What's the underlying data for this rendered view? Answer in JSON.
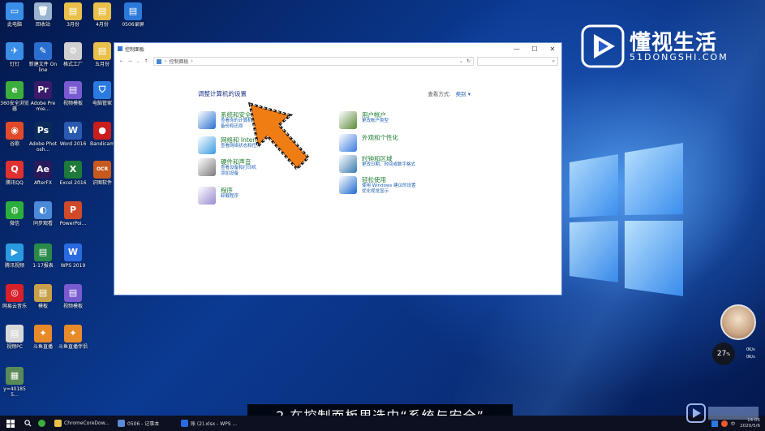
{
  "desktop_icons": [
    {
      "label": "此电脑",
      "color": "#3a8ee6",
      "glyph": "▭"
    },
    {
      "label": "回收站",
      "color": "#9ab3cf",
      "glyph": "🗑"
    },
    {
      "label": "3月份",
      "color": "#e8c04a",
      "glyph": "▤"
    },
    {
      "label": "4月份",
      "color": "#e8c04a",
      "glyph": "▤"
    },
    {
      "label": "0506录屏",
      "color": "#2b79d8",
      "glyph": "▤"
    },
    {
      "label": "钉钉",
      "color": "#3a8ee6",
      "glyph": "✈"
    },
    {
      "label": "新建文件 Online",
      "color": "#2a6fd0",
      "glyph": "✎"
    },
    {
      "label": "格式工厂",
      "color": "#d0d0d0",
      "glyph": "⚙"
    },
    {
      "label": "五月份",
      "color": "#e8c04a",
      "glyph": "▤"
    },
    {
      "label": "360安全浏览器",
      "color": "#3cae3c",
      "glyph": "e"
    },
    {
      "label": "Adobe Premie...",
      "color": "#3a1a6a",
      "glyph": "Pr"
    },
    {
      "label": "视频模板",
      "color": "#7a5ad0",
      "glyph": "▤"
    },
    {
      "label": "电脑管家",
      "color": "#2a7ae0",
      "glyph": "⛉"
    },
    {
      "label": "谷歌",
      "color": "#e04a2a",
      "glyph": "◉"
    },
    {
      "label": "Adobe Photosh...",
      "color": "#0a2a5a",
      "glyph": "Ps"
    },
    {
      "label": "Word 2016",
      "color": "#2a5ab0",
      "glyph": "W"
    },
    {
      "label": "Bandicam",
      "color": "#c81e1e",
      "glyph": "●"
    },
    {
      "label": "腾讯QQ",
      "color": "#e03030",
      "glyph": "Q"
    },
    {
      "label": "AfterFX",
      "color": "#2a1a5a",
      "glyph": "Ae"
    },
    {
      "label": "Excel 2016",
      "color": "#1e7a3a",
      "glyph": "X"
    },
    {
      "label": "识图软件",
      "color": "#c85a1e",
      "glyph": "OCR"
    },
    {
      "label": "微信",
      "color": "#2bae3c",
      "glyph": "◍"
    },
    {
      "label": "同步观看",
      "color": "#4a8ad8",
      "glyph": "◐"
    },
    {
      "label": "PowerPoi...",
      "color": "#d04a2a",
      "glyph": "P"
    },
    {
      "label": "腾讯视频",
      "color": "#2a9ae0",
      "glyph": "▶"
    },
    {
      "label": "1-17报表",
      "color": "#2a8a4a",
      "glyph": "▤"
    },
    {
      "label": "WPS 2019",
      "color": "#2a6ae0",
      "glyph": "W"
    },
    {
      "label": "网易云音乐",
      "color": "#d8202a",
      "glyph": "◎"
    },
    {
      "label": "模板",
      "color": "#c8a04a",
      "glyph": "▤"
    },
    {
      "label": "视频模板",
      "color": "#7a5ad0",
      "glyph": "▤"
    },
    {
      "label": "视频PC",
      "color": "#d8d8d8",
      "glyph": "▤"
    },
    {
      "label": "斗鱼直播",
      "color": "#e88a2a",
      "glyph": "✦"
    },
    {
      "label": "斗鱼直播伴侣",
      "color": "#e88a2a",
      "glyph": "✦"
    },
    {
      "label": "y=401855...",
      "color": "#5a8a5a",
      "glyph": "▦"
    }
  ],
  "window": {
    "title": "控制面板",
    "minimize": "—",
    "maximize": "☐",
    "close": "✕",
    "nav_back": "←",
    "nav_forward": "→",
    "nav_recent": "⌄",
    "nav_up": "↑",
    "breadcrumb": "控制面板",
    "breadcrumb_sep": "›",
    "dropdown": "⌄",
    "refresh": "↻",
    "search_icon": "⌕"
  },
  "control_panel": {
    "heading": "调整计算机的设置",
    "view_by_label": "查看方式:",
    "view_by_value": "类别 ▾",
    "categories_left": [
      {
        "title": "系统和安全",
        "links": [
          "查看你的计算机状态",
          "备份和还原"
        ],
        "icon_color": "#2a6fd0"
      },
      {
        "title": "网络和 Internet",
        "links": [
          "查看网络状态和任务"
        ],
        "icon_color": "#3a9ae0"
      },
      {
        "title": "硬件和声音",
        "links": [
          "查看设备和打印机",
          "添加设备"
        ],
        "icon_color": "#7a7a7a"
      },
      {
        "title": "程序",
        "links": [
          "卸载程序"
        ],
        "icon_color": "#9a8ad0"
      }
    ],
    "categories_right": [
      {
        "title": "用户帐户",
        "links": [
          "更改帐户类型"
        ],
        "icon_color": "#5a8a3a"
      },
      {
        "title": "外观和个性化",
        "links": [],
        "icon_color": "#3a7ae0"
      },
      {
        "title": "时钟和区域",
        "links": [
          "更改日期、时间或数字格式"
        ],
        "icon_color": "#3a7ab0"
      },
      {
        "title": "轻松使用",
        "links": [
          "使用 Windows 建议的设置",
          "优化视觉显示"
        ],
        "icon_color": "#1e6ad0"
      }
    ]
  },
  "watermark": {
    "title": "懂视生活",
    "subtitle": "51DONGSHI.COM"
  },
  "widget": {
    "score": "27",
    "score_unit": "%",
    "stat1": "0K/s",
    "stat2": "0K/s"
  },
  "subtitle": "2.在控制面板里选中“系统与安全”",
  "taskbar": {
    "items": [
      {
        "label": "ChromeCoreDow...",
        "color": "#e8c04a"
      },
      {
        "label": "0506 - 记事本",
        "color": "#5a8ad8"
      },
      {
        "label": "账 (2).xlsx - WPS ...",
        "color": "#2a6ae0"
      }
    ],
    "time": "14:05",
    "date": "2020/5/6",
    "ime": "中"
  },
  "colors": {
    "accent_green": "#1e7d32",
    "link_blue": "#1a5fb4",
    "arrow_orange": "#f07d14"
  }
}
